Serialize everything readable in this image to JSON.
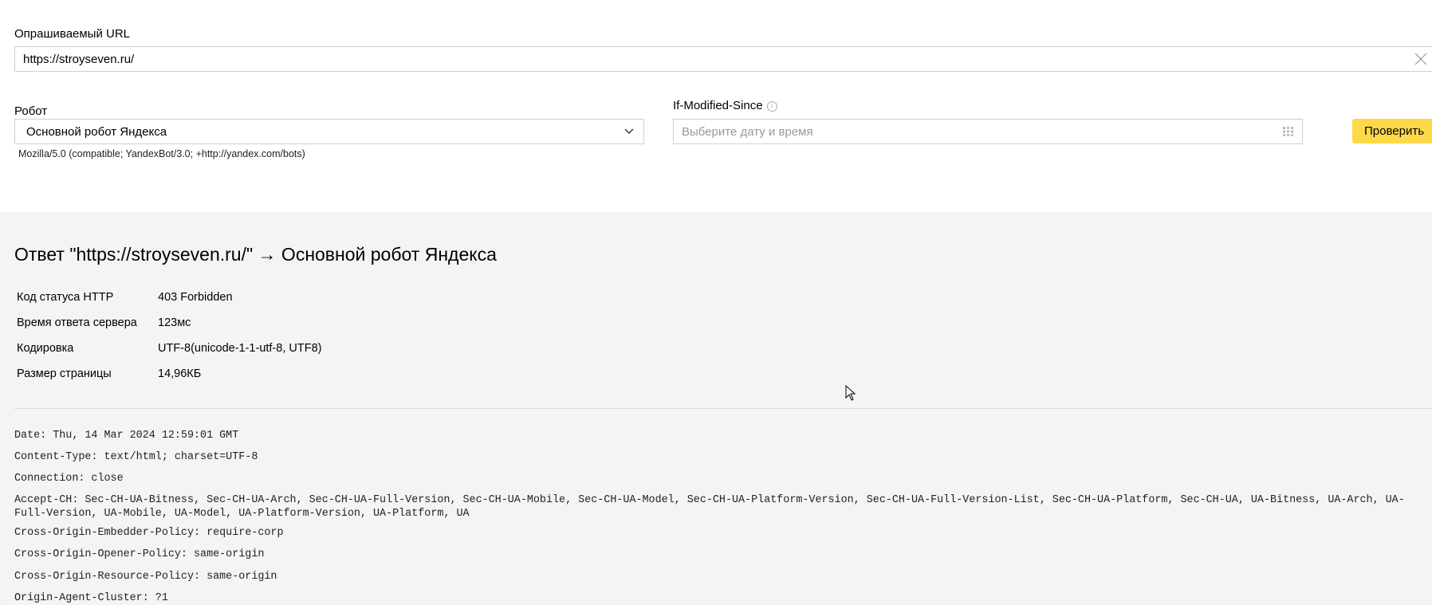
{
  "form": {
    "url_label": "Опрашиваемый URL",
    "url_value": "https://stroyseven.ru/",
    "robot_label": "Робот",
    "robot_value": "Основной робот Яндекса",
    "user_agent": "Mozilla/5.0 (compatible; YandexBot/3.0; +http://yandex.com/bots)",
    "ims_label": "If-Modified-Since",
    "ims_info": "i",
    "ims_placeholder": "Выберите дату и время",
    "check_button": "Проверить",
    "accent": "#fdd94a"
  },
  "result": {
    "title": "Ответ \"https://stroyseven.ru/\" → Основной робот Яндекса",
    "rows": [
      {
        "key": "Код статуса HTTP",
        "value": "403 Forbidden"
      },
      {
        "key": "Время ответа сервера",
        "value": "123мс"
      },
      {
        "key": "Кодировка",
        "value": "UTF-8(unicode-1-1-utf-8, UTF8)"
      },
      {
        "key": "Размер страницы",
        "value": "14,96КБ"
      }
    ],
    "headers": [
      "Date: Thu, 14 Mar 2024 12:59:01 GMT",
      "Content-Type: text/html; charset=UTF-8",
      "Connection: close",
      "Accept-CH: Sec-CH-UA-Bitness, Sec-CH-UA-Arch, Sec-CH-UA-Full-Version, Sec-CH-UA-Mobile, Sec-CH-UA-Model, Sec-CH-UA-Platform-Version, Sec-CH-UA-Full-Version-List, Sec-CH-UA-Platform, Sec-CH-UA, UA-Bitness, UA-Arch, UA-Full-Version, UA-Mobile, UA-Model, UA-Platform-Version, UA-Platform, UA",
      "Cross-Origin-Embedder-Policy: require-corp",
      "Cross-Origin-Opener-Policy: same-origin",
      "Cross-Origin-Resource-Policy: same-origin",
      "Origin-Agent-Cluster: ?1"
    ]
  }
}
